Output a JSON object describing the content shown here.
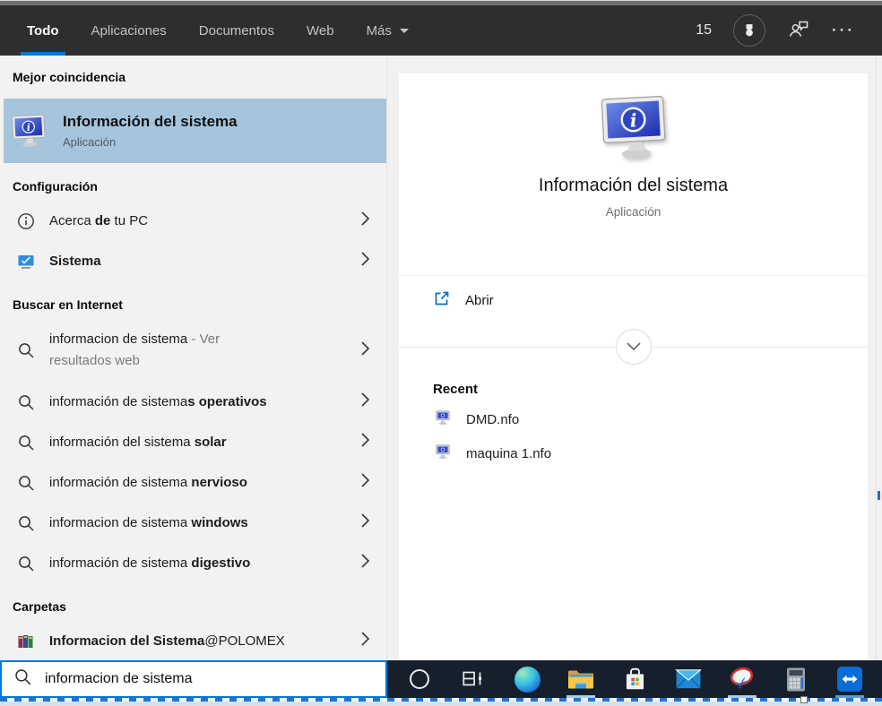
{
  "theme": {
    "accent": "#0078d7",
    "selection_bg": "#a6c5dd",
    "header_bg": "#2e2e2e",
    "taskbar_bg": "#16202c",
    "panel_bg": "#f2f2f2"
  },
  "header": {
    "tabs": [
      {
        "label": "Todo"
      },
      {
        "label": "Aplicaciones"
      },
      {
        "label": "Documentos"
      },
      {
        "label": "Web"
      },
      {
        "label": "Más"
      }
    ],
    "rewards_count": "15",
    "more_glyph": "···"
  },
  "left_panel": {
    "best_match_label": "Mejor coincidencia",
    "best_match": {
      "title": "Información del sistema",
      "subtitle": "Aplicación"
    },
    "settings_label": "Configuración",
    "settings_items": [
      {
        "pre": "Acerca ",
        "bold": "de",
        "post": " tu PC"
      },
      {
        "pre": "",
        "bold": "Sistema",
        "post": ""
      }
    ],
    "web_label": "Buscar en Internet",
    "web_first": {
      "query": "informacion de sistema",
      "suffix": " - Ver resultados web"
    },
    "web_items": [
      {
        "regular": "información de sistema",
        "bold": "s operativos"
      },
      {
        "regular": "información del sistema ",
        "bold": "solar"
      },
      {
        "regular": "información de sistema ",
        "bold": "nervioso"
      },
      {
        "regular": "informacion de sistema ",
        "bold": "windows"
      },
      {
        "regular": "información de sistema ",
        "bold": "digestivo"
      }
    ],
    "folders_label": "Carpetas",
    "folder_item": {
      "bold": "Informacion del Sistema",
      "regular": "@POLOMEX"
    }
  },
  "preview": {
    "title": "Información del sistema",
    "subtitle": "Aplicación",
    "open_label": "Abrir",
    "recent_label": "Recent",
    "recent_items": [
      {
        "name": "DMD.nfo"
      },
      {
        "name": "maquina 1.nfo"
      }
    ]
  },
  "search_box": {
    "value": "informacion de sistema"
  },
  "taskbar": {
    "items": [
      {
        "name": "cortana"
      },
      {
        "name": "task-view"
      },
      {
        "name": "edge"
      },
      {
        "name": "file-explorer",
        "running": true
      },
      {
        "name": "store"
      },
      {
        "name": "mail"
      },
      {
        "name": "snipping-tool",
        "running": true
      },
      {
        "name": "calculator"
      },
      {
        "name": "teamviewer",
        "running": true
      }
    ]
  },
  "glyphs": {
    "scissors": "✂"
  }
}
